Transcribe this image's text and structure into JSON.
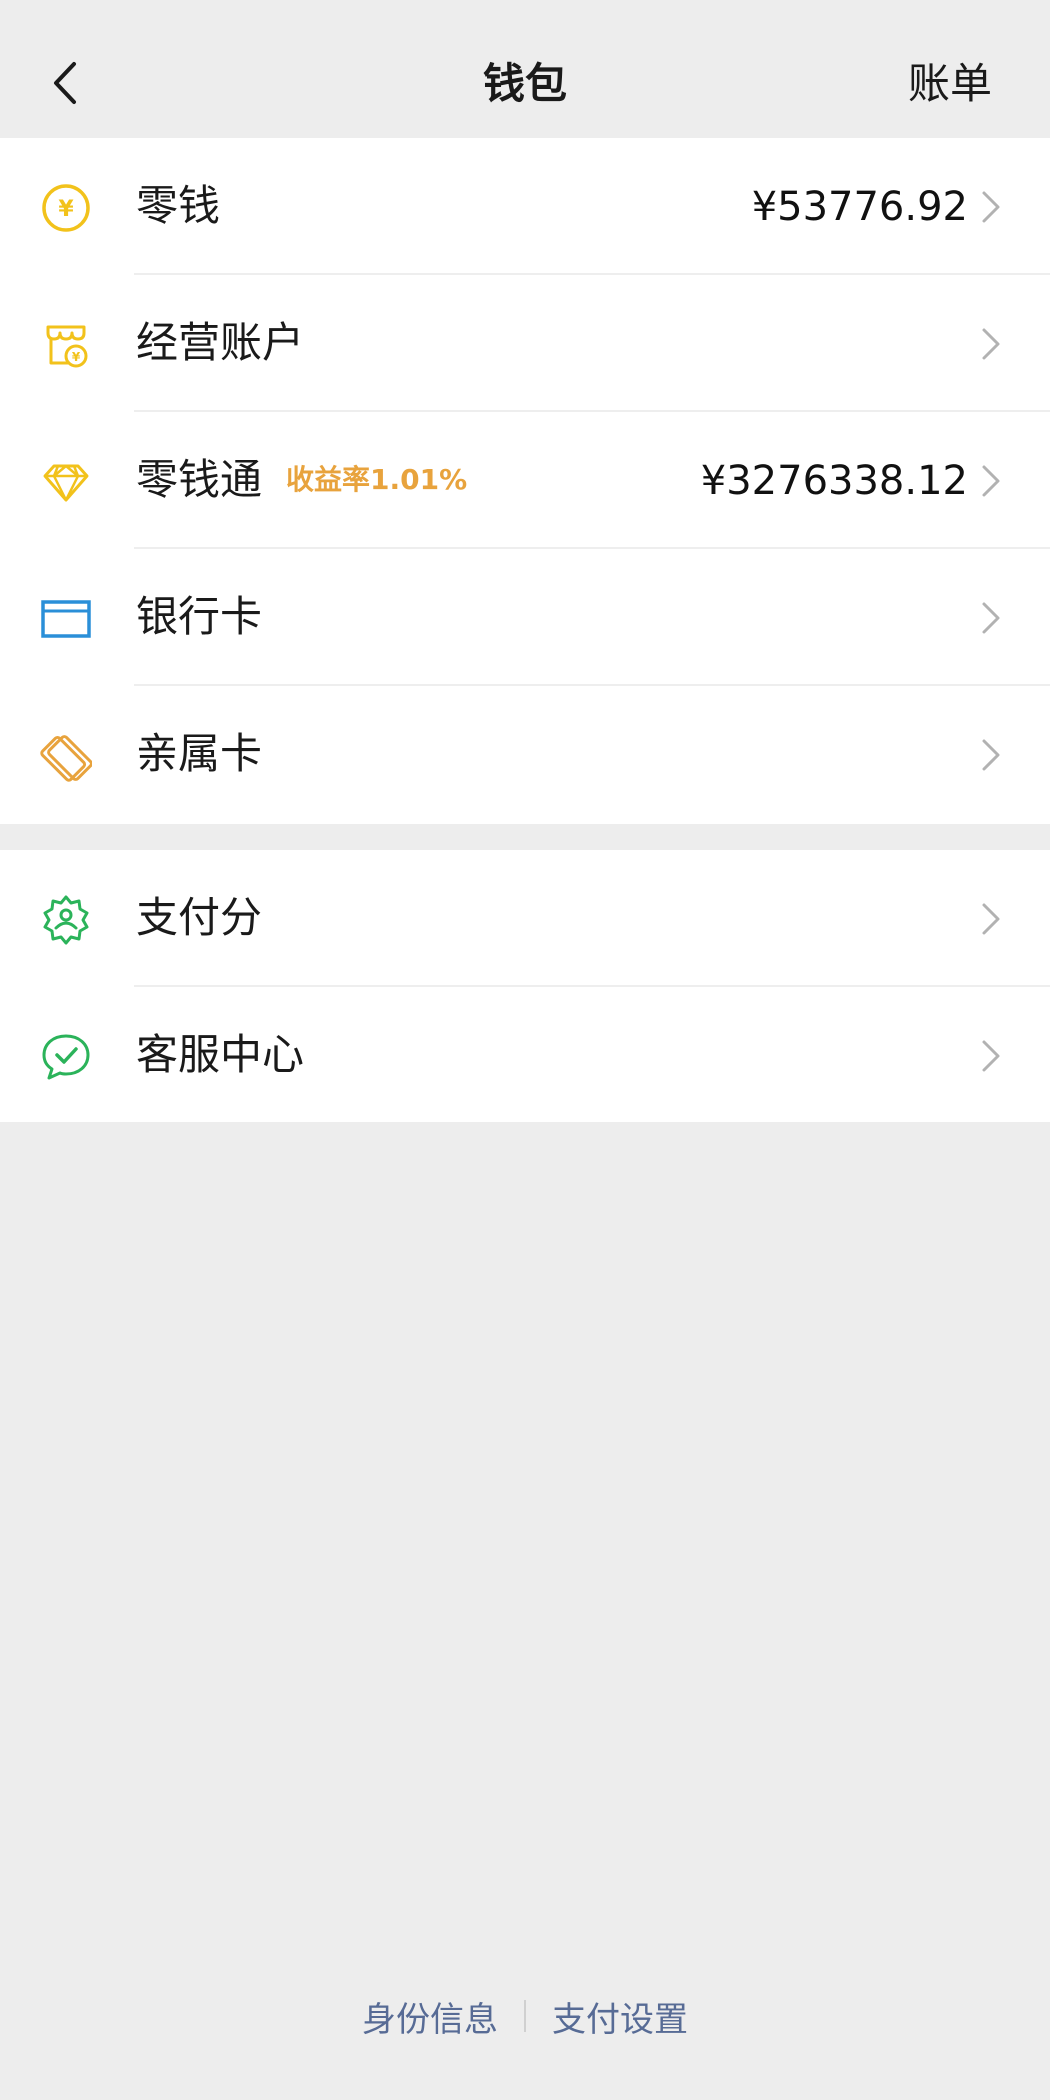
{
  "header": {
    "title": "钱包",
    "right_action": "账单",
    "back_icon": "chevron-left-icon"
  },
  "groups": [
    {
      "items": [
        {
          "icon": "yen-coin-icon",
          "label": "零钱",
          "value": "¥53776.92",
          "color": "#f2c21b"
        },
        {
          "icon": "store-account-icon",
          "label": "经营账户",
          "value": "",
          "color": "#f2c21b"
        },
        {
          "icon": "diamond-icon",
          "label": "零钱通",
          "badge": "收益率1.01%",
          "value": "¥3276338.12",
          "color": "#f2c21b"
        },
        {
          "icon": "bank-card-icon",
          "label": "银行卡",
          "value": "",
          "color": "#2a8fd8"
        },
        {
          "icon": "family-card-icon",
          "label": "亲属卡",
          "value": "",
          "color": "#e8a33d"
        }
      ]
    },
    {
      "items": [
        {
          "icon": "pay-score-icon",
          "label": "支付分",
          "value": "",
          "color": "#2bb35a"
        },
        {
          "icon": "customer-service-icon",
          "label": "客服中心",
          "value": "",
          "color": "#2bb35a"
        }
      ]
    }
  ],
  "footer": {
    "links": [
      "身份信息",
      "支付设置"
    ],
    "color": "#576b95"
  }
}
